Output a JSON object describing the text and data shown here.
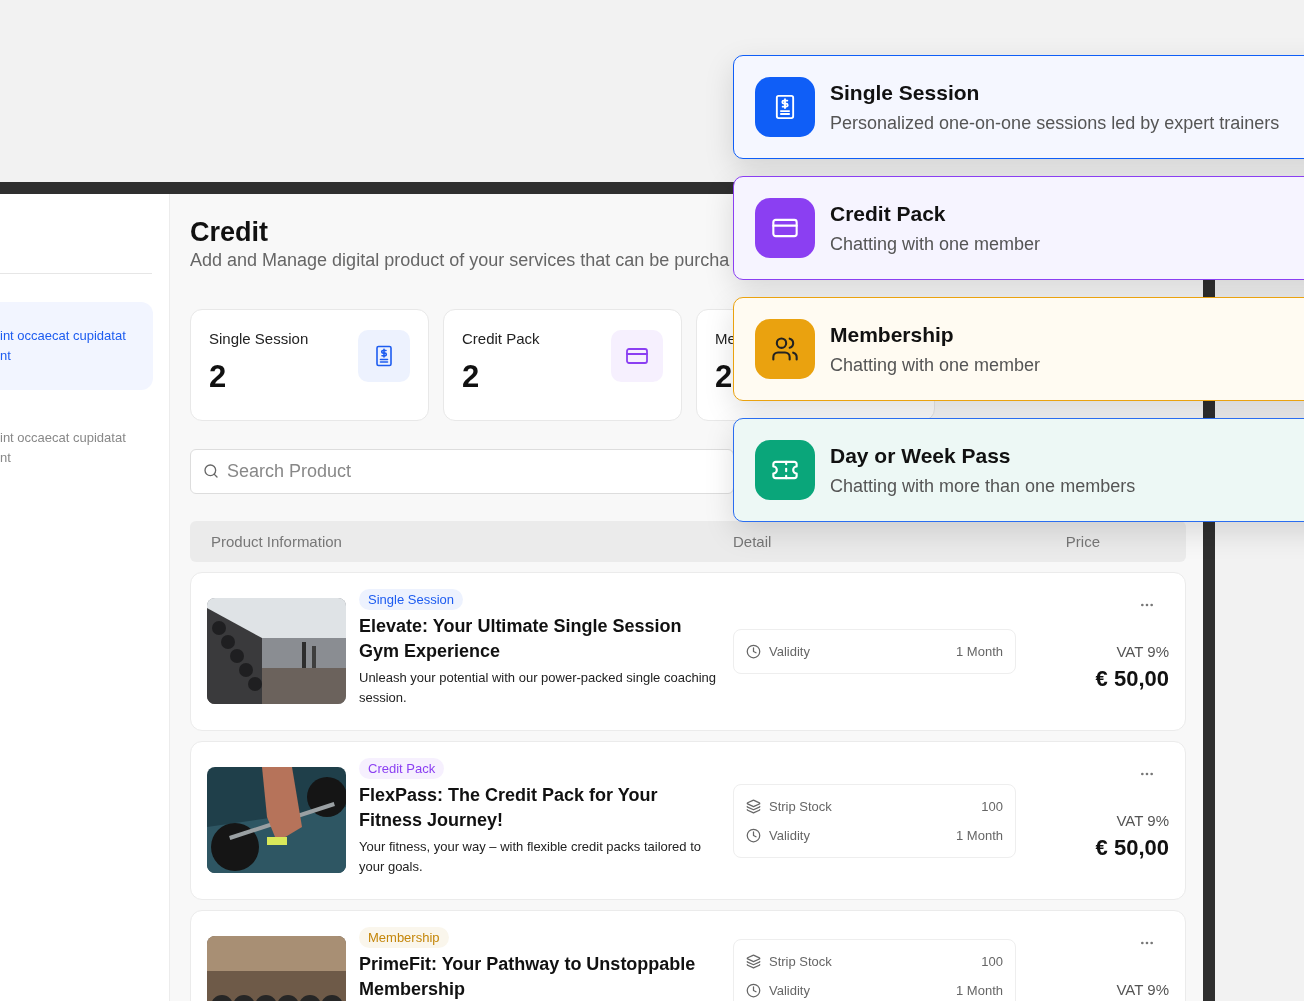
{
  "sidebar": {
    "items": [
      {
        "text": "int occaecat cupidatat nt",
        "selected": true
      },
      {
        "text": "int occaecat cupidatat nt",
        "selected": false
      }
    ]
  },
  "header": {
    "title": "Credit",
    "subtitle": "Add and Manage digital product of your services that can be purcha"
  },
  "stats": [
    {
      "kind": "session",
      "label": "Single Session",
      "value": "2",
      "color": "#1d5cf0"
    },
    {
      "kind": "credit",
      "label": "Credit Pack",
      "value": "2",
      "color": "#8b3ff2"
    },
    {
      "label": "Me",
      "value": "2"
    }
  ],
  "search": {
    "placeholder": "Search Product"
  },
  "table": {
    "columns": [
      "Product Information",
      "Detail",
      "Price"
    ],
    "rows": [
      {
        "tag": {
          "text": "Single Session",
          "color": "#1d5cf0"
        },
        "title": "Elevate: Your Ultimate Single Session Gym Experience",
        "description": "Unleash your potential with our power-packed single coaching session.",
        "details": [
          {
            "kind": "validity",
            "label": "Validity",
            "value": "1 Month"
          }
        ],
        "vat": "VAT 9%",
        "price": "€ 50,00"
      },
      {
        "tag": {
          "text": "Credit Pack",
          "color": "#8b3ff2"
        },
        "title": "FlexPass: The Credit Pack for Your Fitness Journey!",
        "description": "Your fitness, your way – with flexible credit packs tailored to your goals.",
        "details": [
          {
            "kind": "stock",
            "label": "Strip Stock",
            "value": "100"
          },
          {
            "kind": "validity",
            "label": "Validity",
            "value": "1 Month"
          }
        ],
        "vat": "VAT 9%",
        "price": "€ 50,00"
      },
      {
        "tag": {
          "text": "Membership",
          "color": "#c4860a"
        },
        "title": "PrimeFit: Your Pathway to Unstoppable Membership",
        "details": [
          {
            "kind": "stock",
            "label": "Strip Stock",
            "value": "100"
          },
          {
            "kind": "validity",
            "label": "Validity",
            "value": "1 Month"
          }
        ],
        "vat": "VAT 9%"
      }
    ]
  },
  "product_types": [
    {
      "kind": "session",
      "title": "Single Session",
      "description": "Personalized one-on-one sessions led by expert trainers",
      "color": "#0f5ef7",
      "selected": false
    },
    {
      "kind": "credit",
      "title": "Credit Pack",
      "description": "Chatting with one member",
      "color": "#8b3ff2",
      "selected": false
    },
    {
      "kind": "membership",
      "title": "Membership",
      "description": "Chatting with one member",
      "color": "#eaa20f",
      "selected": false
    },
    {
      "kind": "pass",
      "title": "Day or Week Pass",
      "description": "Chatting with more than one members",
      "color": "#0aa67a",
      "selected": true
    }
  ]
}
